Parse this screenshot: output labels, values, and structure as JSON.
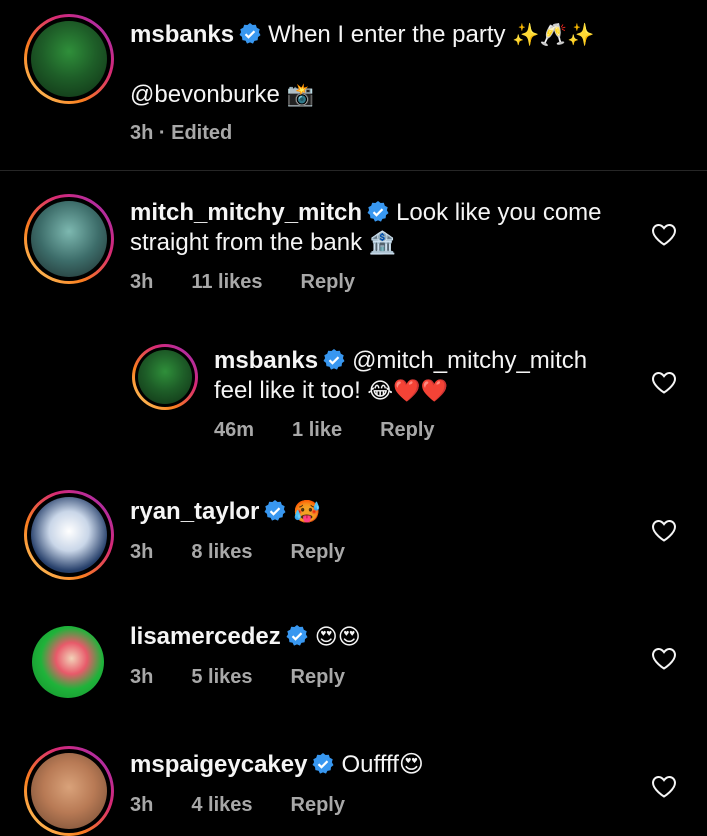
{
  "caption": {
    "username": "msbanks",
    "text": "When I enter the party",
    "emojis": "✨🥂✨",
    "line2": "@bevonburke",
    "line2_emoji": "📸",
    "meta": "3h · Edited"
  },
  "comments": [
    {
      "username": "mitch_mitchy_mitch",
      "text_line1": "Look like you come",
      "text_line2": "straight from the bank",
      "emoji": "🏦",
      "time": "3h",
      "likes": "11 likes",
      "reply": "Reply"
    },
    {
      "username": "msbanks",
      "text_line1": "@mitch_mitchy_mitch",
      "text_line2": "feel like it too!",
      "emoji": "😂❤️❤️",
      "time": "46m",
      "likes": "1 like",
      "reply": "Reply"
    },
    {
      "username": "ryan_taylor",
      "text_line1": "🥵",
      "time": "3h",
      "likes": "8 likes",
      "reply": "Reply"
    },
    {
      "username": "lisamercedez",
      "text_line1": "😍😍",
      "time": "3h",
      "likes": "5 likes",
      "reply": "Reply"
    },
    {
      "username": "mspaigeycakey",
      "text_line1": "Ouffff😍",
      "time": "3h",
      "likes": "4 likes",
      "reply": "Reply"
    }
  ],
  "colors": {
    "background": "#000000",
    "verified": "#3897f0",
    "meta": "#a8a8a8"
  }
}
